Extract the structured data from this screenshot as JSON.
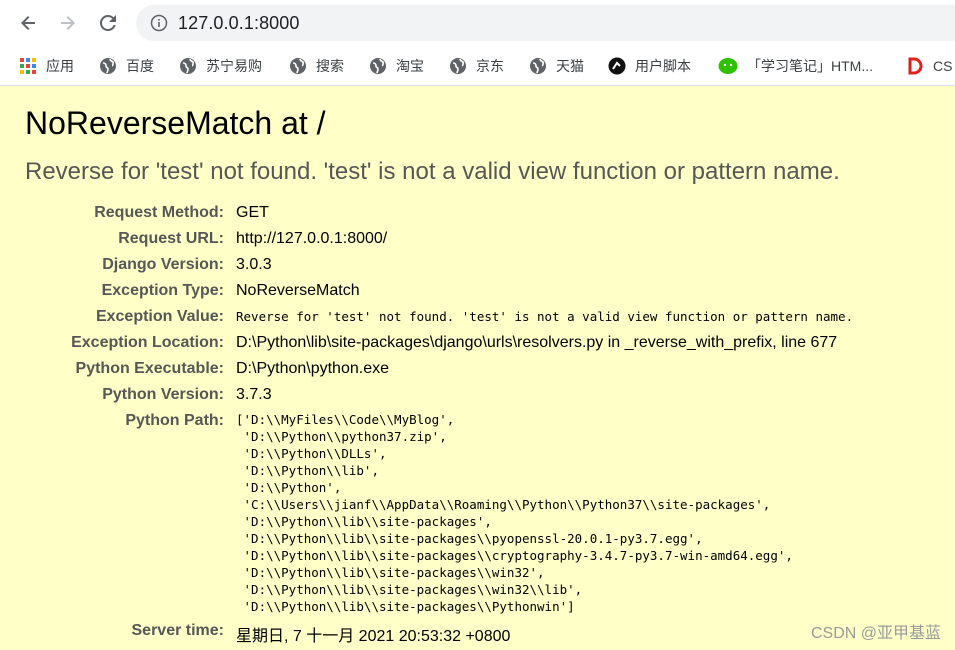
{
  "browser": {
    "url": "127.0.0.1:8000",
    "bookmarks": [
      {
        "label": "应用",
        "icon": "apps-grid-icon"
      },
      {
        "label": "百度",
        "icon": "globe-icon"
      },
      {
        "label": "苏宁易购",
        "icon": "globe-icon"
      },
      {
        "label": "搜索",
        "icon": "globe-icon"
      },
      {
        "label": "淘宝",
        "icon": "globe-icon"
      },
      {
        "label": "京东",
        "icon": "globe-icon"
      },
      {
        "label": "天猫",
        "icon": "globe-icon"
      },
      {
        "label": "用户脚本",
        "icon": "tampermonkey-icon"
      },
      {
        "label": "「学习笔记」HTM...",
        "icon": "wechat-icon"
      },
      {
        "label": "CS",
        "icon": "csdn-icon"
      }
    ]
  },
  "error": {
    "title": "NoReverseMatch at /",
    "message": "Reverse for 'test' not found. 'test' is not a valid view function or pattern name.",
    "details": [
      {
        "key": "Request Method:",
        "value": "GET"
      },
      {
        "key": "Request URL:",
        "value": "http://127.0.0.1:8000/"
      },
      {
        "key": "Django Version:",
        "value": "3.0.3"
      },
      {
        "key": "Exception Type:",
        "value": "NoReverseMatch"
      },
      {
        "key": "Exception Value:",
        "value": "Reverse for 'test' not found. 'test' is not a valid view function or pattern name."
      },
      {
        "key": "Exception Location:",
        "value": "D:\\Python\\lib\\site-packages\\django\\urls\\resolvers.py in _reverse_with_prefix, line 677"
      },
      {
        "key": "Python Executable:",
        "value": "D:\\Python\\python.exe"
      },
      {
        "key": "Python Version:",
        "value": "3.7.3"
      },
      {
        "key": "Python Path:",
        "value": ""
      },
      {
        "key": "Server time:",
        "value": "星期日, 7 十一月 2021 20:53:32 +0800"
      }
    ],
    "python_path": [
      "['D:\\\\MyFiles\\\\Code\\\\MyBlog',",
      " 'D:\\\\Python\\\\python37.zip',",
      " 'D:\\\\Python\\\\DLLs',",
      " 'D:\\\\Python\\\\lib',",
      " 'D:\\\\Python',",
      " 'C:\\\\Users\\\\jianf\\\\AppData\\\\Roaming\\\\Python\\\\Python37\\\\site-packages',",
      " 'D:\\\\Python\\\\lib\\\\site-packages',",
      " 'D:\\\\Python\\\\lib\\\\site-packages\\\\pyopenssl-20.0.1-py3.7.egg',",
      " 'D:\\\\Python\\\\lib\\\\site-packages\\\\cryptography-3.4.7-py3.7-win-amd64.egg',",
      " 'D:\\\\Python\\\\lib\\\\site-packages\\\\win32',",
      " 'D:\\\\Python\\\\lib\\\\site-packages\\\\win32\\\\lib',",
      " 'D:\\\\Python\\\\lib\\\\site-packages\\\\Pythonwin']"
    ]
  },
  "watermark": "CSDN @亚甲基蓝",
  "colors": {
    "page_background": "#ffffc8",
    "label_grey": "#575757"
  }
}
